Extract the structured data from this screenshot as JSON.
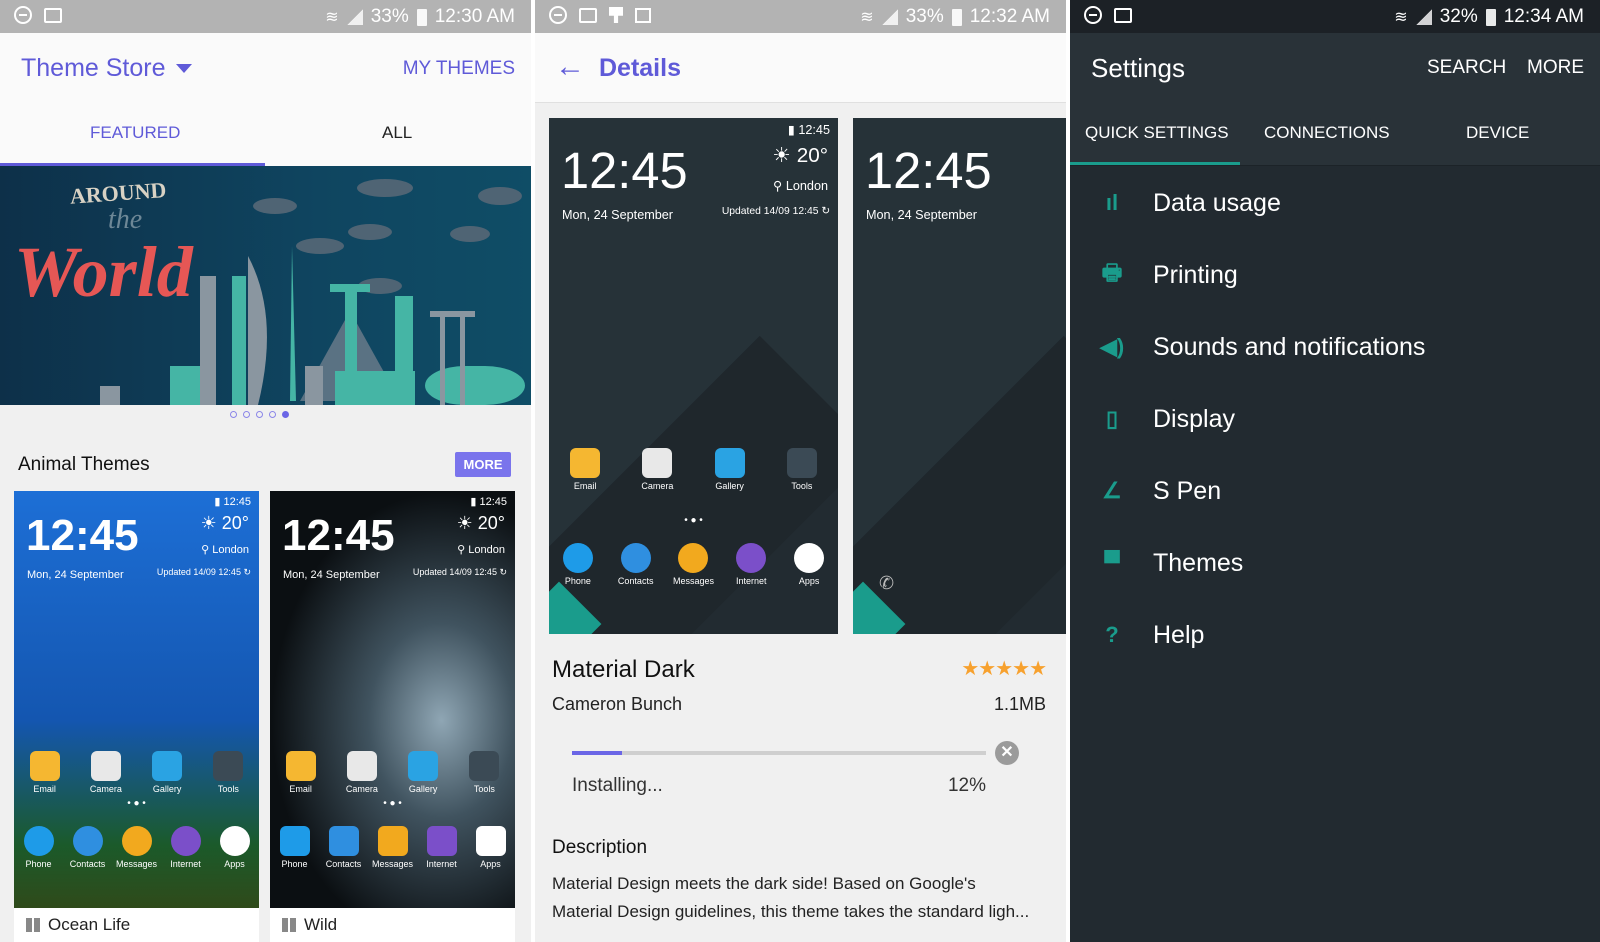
{
  "colors": {
    "accent": "#5f5ad8",
    "teal": "#1a9c8c",
    "star": "#f7a12e"
  },
  "panel1": {
    "status": {
      "battery": "33%",
      "time": "12:30 AM"
    },
    "title": "Theme Store",
    "my_themes": "MY THEMES",
    "tabs": [
      {
        "label": "FEATURED",
        "active": true
      },
      {
        "label": "ALL",
        "active": false
      }
    ],
    "banner": {
      "line1": "AROUND",
      "line2": "the",
      "line3": "World",
      "page_count": 5,
      "active_page": 5
    },
    "section_title": "Animal Themes",
    "more": "MORE",
    "themes": [
      {
        "name": "Ocean Life",
        "preview": {
          "status_time": "12:45",
          "clock": "12:45",
          "date": "Mon, 24 September",
          "temp": "20°",
          "city": "London",
          "updated": "Updated 14/09 12:45",
          "home": [
            "Email",
            "Camera",
            "Gallery",
            "Tools"
          ],
          "dock": [
            "Phone",
            "Contacts",
            "Messages",
            "Internet",
            "Apps"
          ]
        }
      },
      {
        "name": "Wild",
        "preview": {
          "status_time": "12:45",
          "clock": "12:45",
          "date": "Mon, 24 September",
          "temp": "20°",
          "city": "London",
          "updated": "Updated 14/09 12:45",
          "home": [
            "Email",
            "Camera",
            "Gallery",
            "Tools"
          ],
          "dock": [
            "Phone",
            "Contacts",
            "Messages",
            "Internet",
            "Apps"
          ]
        }
      }
    ]
  },
  "panel2": {
    "status": {
      "battery": "33%",
      "time": "12:32 AM"
    },
    "title": "Details",
    "preview1": {
      "status_time": "12:45",
      "clock": "12:45",
      "date": "Mon, 24 September",
      "temp": "20°",
      "city": "London",
      "updated": "Updated 14/09 12:45",
      "home": [
        "Email",
        "Camera",
        "Gallery",
        "Tools"
      ],
      "dock": [
        "Phone",
        "Contacts",
        "Messages",
        "Internet",
        "Apps"
      ]
    },
    "preview2": {
      "clock": "12:45",
      "date": "Mon, 24 September"
    },
    "theme_name": "Material Dark",
    "author": "Cameron Bunch",
    "size": "1.1MB",
    "rating": 5,
    "progress": {
      "status": "Installing...",
      "percent_label": "12%",
      "value": 12
    },
    "description_title": "Description",
    "description": [
      "Material Design meets the dark side! Based on Google's",
      "Material Design guidelines, this theme takes the standard ligh..."
    ]
  },
  "panel3": {
    "status": {
      "battery": "32%",
      "time": "12:34 AM"
    },
    "title": "Settings",
    "search": "SEARCH",
    "more": "MORE",
    "tabs": [
      {
        "label": "QUICK SETTINGS",
        "active": true
      },
      {
        "label": "CONNECTIONS"
      },
      {
        "label": "DEVICE"
      }
    ],
    "items": [
      {
        "label": "Data usage",
        "icon": "bar-chart-icon"
      },
      {
        "label": "Printing",
        "icon": "printer-icon"
      },
      {
        "label": "Sounds and notifications",
        "icon": "speaker-icon"
      },
      {
        "label": "Display",
        "icon": "display-settings-icon"
      },
      {
        "label": "S Pen",
        "icon": "pen-icon"
      },
      {
        "label": "Themes",
        "icon": "paint-roller-icon"
      },
      {
        "label": "Help",
        "icon": "help-icon"
      }
    ]
  }
}
